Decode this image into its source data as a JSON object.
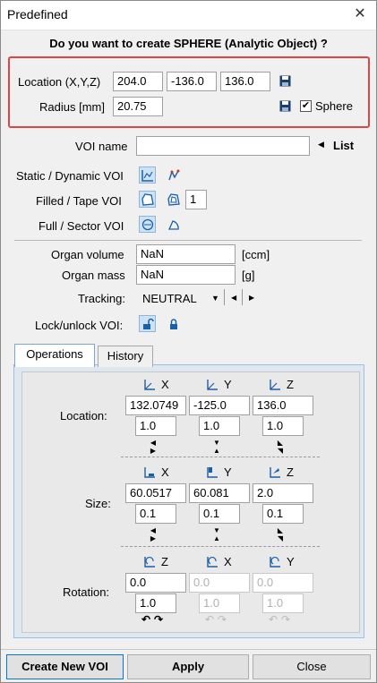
{
  "window": {
    "title": "Predefined"
  },
  "question": "Do you want to create SPHERE (Analytic Object) ?",
  "location": {
    "label": "Location (X,Y,Z)",
    "x": "204.0",
    "y": "-136.0",
    "z": "136.0"
  },
  "radius": {
    "label": "Radius [mm]",
    "value": "20.75",
    "sphere_label": "Sphere",
    "sphere_checked": "✔"
  },
  "voi_name": {
    "label": "VOI name",
    "value": "",
    "list_label": "List"
  },
  "static_dynamic": {
    "label": "Static / Dynamic VOI"
  },
  "filled_tape": {
    "label": "Filled / Tape VOI",
    "value": "1"
  },
  "full_sector": {
    "label": "Full / Sector VOI"
  },
  "organ_volume": {
    "label": "Organ volume",
    "value": "NaN",
    "unit": "[ccm]"
  },
  "organ_mass": {
    "label": "Organ mass",
    "value": "NaN",
    "unit": "[g]"
  },
  "tracking": {
    "label": "Tracking:",
    "value": "NEUTRAL"
  },
  "lock": {
    "label": "Lock/unlock VOI:"
  },
  "tabs": [
    "Operations",
    "History"
  ],
  "operations": {
    "location": {
      "label": "Location:",
      "axes": [
        "X",
        "Y",
        "Z"
      ],
      "values": [
        "132.0749",
        "-125.0",
        "136.0"
      ],
      "steps": [
        "1.0",
        "1.0",
        "1.0"
      ]
    },
    "size": {
      "label": "Size:",
      "axes": [
        "X",
        "Y",
        "Z"
      ],
      "values": [
        "60.0517",
        "60.081",
        "2.0"
      ],
      "steps": [
        "0.1",
        "0.1",
        "0.1"
      ]
    },
    "rotation": {
      "label": "Rotation:",
      "axes": [
        "Z",
        "X",
        "Y"
      ],
      "values": [
        "0.0",
        "0.0",
        "0.0"
      ],
      "steps": [
        "1.0",
        "1.0",
        "1.0"
      ]
    }
  },
  "buttons": {
    "create": "Create New VOI",
    "apply": "Apply",
    "close": "Close"
  },
  "colors": {
    "highlight": "#e04545",
    "accent": "#0078d7",
    "icon_blue": "#1b5fa8"
  }
}
